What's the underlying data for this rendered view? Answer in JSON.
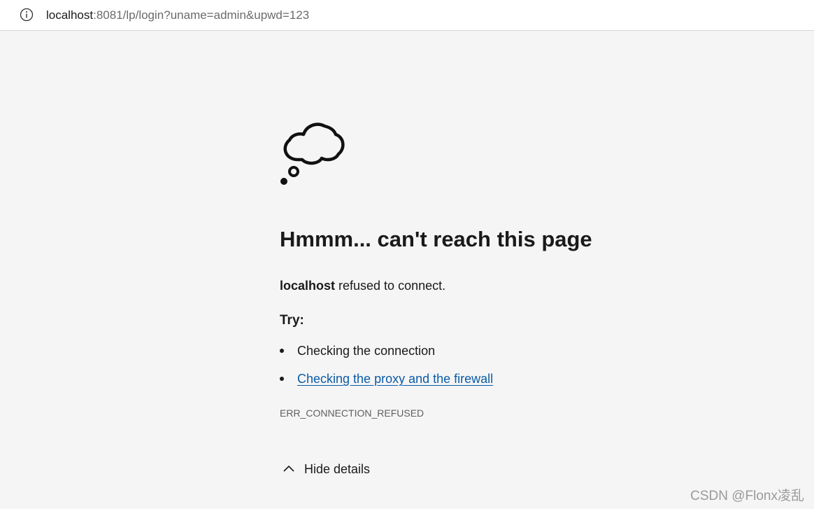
{
  "address_bar": {
    "url_host": "localhost",
    "url_rest": ":8081/lp/login?uname=admin&upwd=123",
    "icon": "info-icon"
  },
  "error_page": {
    "icon": "thought-cloud-icon",
    "title": "Hmmm... can't reach this page",
    "host": "localhost",
    "message": " refused to connect.",
    "try_label": "Try:",
    "suggestions": [
      "Checking the connection",
      "Checking the proxy and the firewall"
    ],
    "error_code": "ERR_CONNECTION_REFUSED",
    "details_toggle": "Hide details",
    "link_color": "#0a5ba8"
  },
  "watermark": "CSDN @Flonx凌乱"
}
